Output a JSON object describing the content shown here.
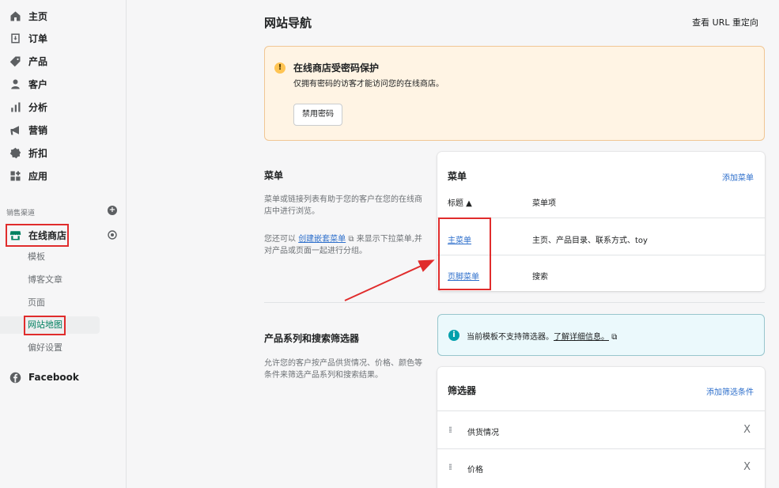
{
  "sidebar": {
    "items": [
      {
        "label": "主页",
        "icon": "home-icon"
      },
      {
        "label": "订单",
        "icon": "orders-icon"
      },
      {
        "label": "产品",
        "icon": "tag-icon"
      },
      {
        "label": "客户",
        "icon": "person-icon"
      },
      {
        "label": "分析",
        "icon": "bar-chart-icon"
      },
      {
        "label": "营销",
        "icon": "megaphone-icon"
      },
      {
        "label": "折扣",
        "icon": "discount-icon"
      },
      {
        "label": "应用",
        "icon": "apps-icon"
      }
    ],
    "channels_heading": "销售渠道",
    "online_store": "在线商店",
    "sub_items": [
      "模板",
      "博客文章",
      "页面",
      "网站地图",
      "偏好设置"
    ],
    "active_sub_item": "网站地图",
    "facebook": "Facebook"
  },
  "header": {
    "title": "网站导航",
    "redirect_link": "查看 URL 重定向"
  },
  "password_banner": {
    "title": "在线商店受密码保护",
    "description": "仅拥有密码的访客才能访问您的在线商店。",
    "button": "禁用密码"
  },
  "menus_section": {
    "title": "菜单",
    "description": "菜单或链接列表有助于您的客户在您的在线商店中进行浏览。",
    "hint_prefix": "您还可以",
    "hint_link": "创建嵌套菜单",
    "hint_suffix": "来显示下拉菜单,并对产品或页面一起进行分组。",
    "card_title": "菜单",
    "add_link": "添加菜单",
    "col_title": "标题 ▲",
    "col_items": "菜单项",
    "rows": [
      {
        "title": "主菜单",
        "items": "主页、产品目录、联系方式、toy"
      },
      {
        "title": "页脚菜单",
        "items": "搜索"
      }
    ]
  },
  "filters_section": {
    "title": "产品系列和搜索筛选器",
    "description": "允许您的客户按产品供货情况、价格、颜色等条件来筛选产品系列和搜索结果。",
    "info_text": "当前模板不支持筛选器。",
    "info_link": "了解详细信息。",
    "card_title": "筛选器",
    "add_link": "添加筛选条件",
    "rows": [
      {
        "label": "供货情况"
      },
      {
        "label": "价格"
      }
    ]
  },
  "colors": {
    "accent": "#008060",
    "link": "#2c6ecb",
    "highlight_red": "#e02c2c"
  }
}
